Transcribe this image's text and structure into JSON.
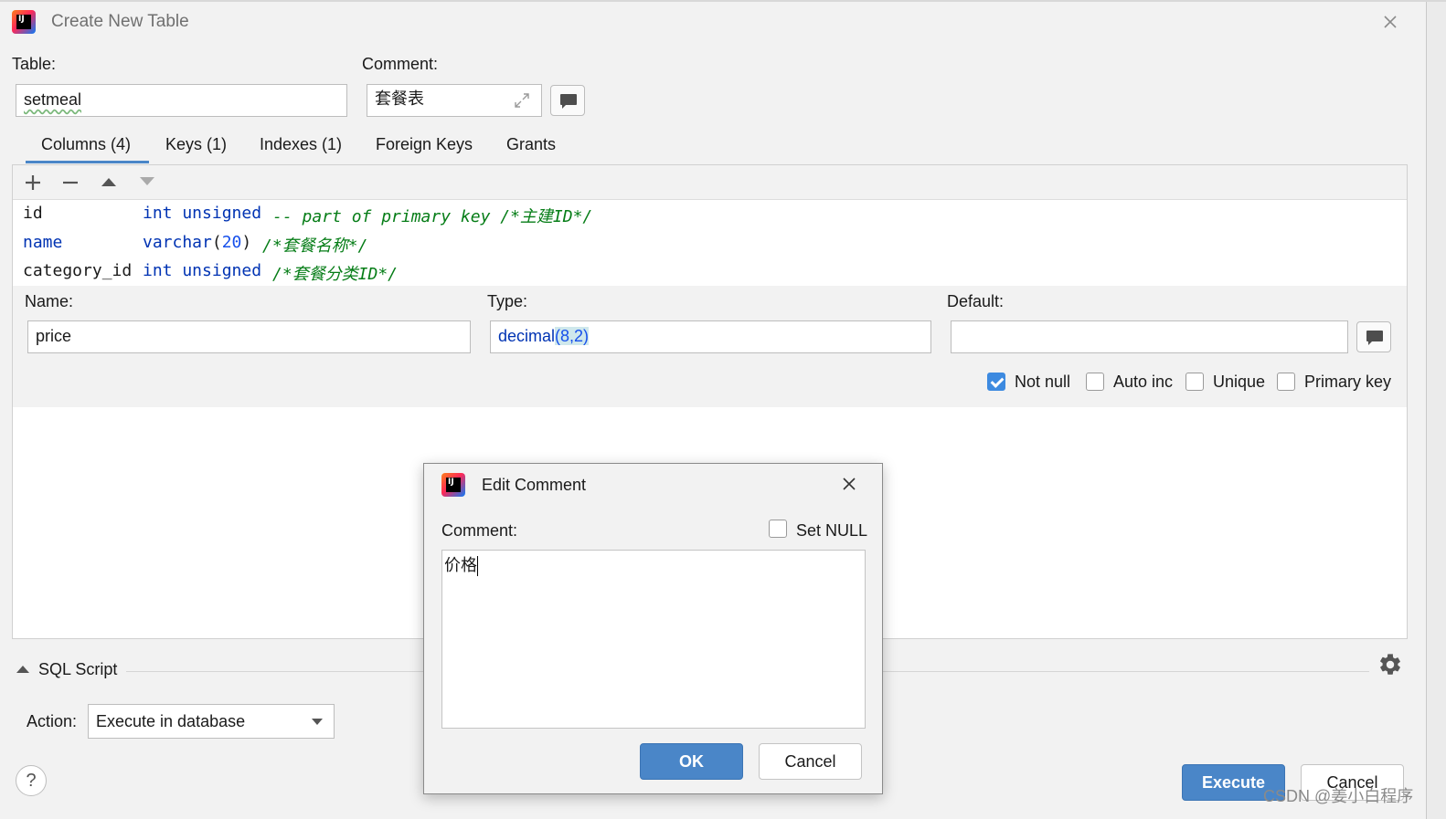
{
  "window": {
    "title": "Create New Table"
  },
  "table_label": "Table:",
  "table_value": "setmeal",
  "comment_label": "Comment:",
  "comment_value": "套餐表",
  "tabs": [
    {
      "label": "Columns (4)"
    },
    {
      "label": "Keys (1)"
    },
    {
      "label": "Indexes (1)"
    },
    {
      "label": "Foreign Keys"
    },
    {
      "label": "Grants"
    }
  ],
  "toolbar": {
    "add": "+",
    "remove": "−"
  },
  "columns": [
    {
      "name": "id",
      "type_kw": "int unsigned",
      "comment": "-- part of primary key /*主建ID*/"
    },
    {
      "name": "name",
      "type_kw": "varchar",
      "type_open": "(",
      "type_num": "20",
      "type_close": ")",
      "comment": "/*套餐名称*/"
    },
    {
      "name": "category_id",
      "type_kw": "int unsigned",
      "comment": "/*套餐分类ID*/"
    }
  ],
  "editor": {
    "name_label": "Name:",
    "name_value": "price",
    "type_label": "Type:",
    "type_kw": "decimal",
    "type_args": "(8,2)",
    "default_label": "Default:",
    "default_value": "",
    "checkboxes": [
      {
        "label": "Not null",
        "checked": true
      },
      {
        "label": "Auto inc",
        "checked": false
      },
      {
        "label": "Unique",
        "checked": false
      },
      {
        "label": "Primary key",
        "checked": false
      }
    ]
  },
  "sql_script_label": "SQL Script",
  "action_label": "Action:",
  "action_value": "Execute in database",
  "help_label": "?",
  "execute_label": "Execute",
  "cancel_label": "Cancel",
  "watermark": "CSDN @姜小白程序",
  "dialog": {
    "title": "Edit Comment",
    "comment_label": "Comment:",
    "setnull_label": "Set NULL",
    "text": "价格",
    "ok_label": "OK",
    "cancel_label": "Cancel"
  },
  "colors": {
    "accent": "#4a86c8",
    "keyword": "#0033b3",
    "comment": "#067d17",
    "number": "#1750eb"
  }
}
